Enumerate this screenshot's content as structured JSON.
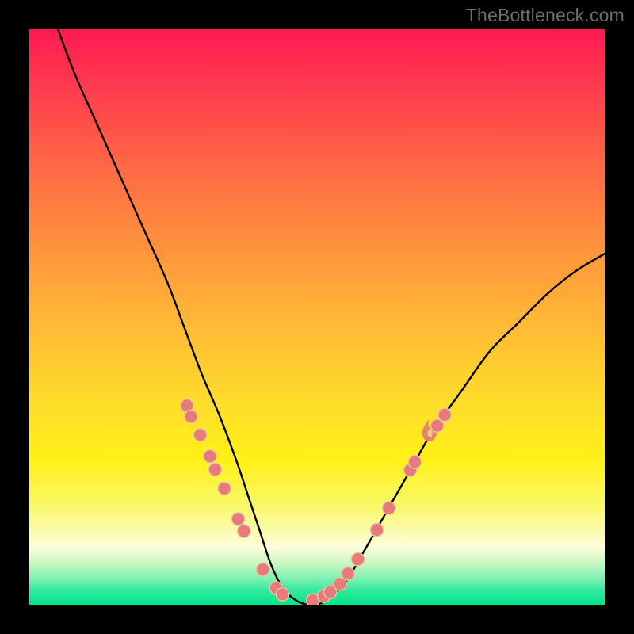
{
  "watermark": "TheBottleneck.com",
  "colors": {
    "frame": "#000000",
    "curve": "#000000",
    "dot_fill": "#e97a7a",
    "dot_stroke": "#e4c8a1",
    "gradient_top": "#ff1a52",
    "gradient_bottom": "#00e588"
  },
  "chart_data": {
    "type": "line",
    "title": "",
    "xlabel": "",
    "ylabel": "",
    "xlim": [
      0,
      100
    ],
    "ylim": [
      0,
      100
    ],
    "notes": "Bottleneck curve. No axis ticks or numeric labels are shown; x and y are normalized 0–100 within the plot area. y=0 is the bottom (green) edge, y=100 is the top (red) edge. Minimum (y≈0) is a flat region roughly x∈[42,52].",
    "series": [
      {
        "name": "bottleneck-curve",
        "x": [
          5,
          8,
          12,
          16,
          20,
          24,
          27,
          30,
          33,
          36,
          38,
          40,
          42,
          44,
          46,
          48,
          50,
          52,
          55,
          58,
          62,
          66,
          70,
          75,
          80,
          85,
          90,
          95,
          100
        ],
        "y": [
          100,
          92,
          83,
          74,
          65,
          56,
          48,
          40,
          33,
          25,
          19,
          13,
          7,
          3,
          1,
          0,
          0,
          1,
          4,
          9,
          16,
          23,
          30,
          37,
          44,
          49,
          54,
          58,
          61
        ]
      }
    ],
    "dots_left": [
      {
        "x": 27.4,
        "y": 34.6
      },
      {
        "x": 28.1,
        "y": 32.7
      },
      {
        "x": 29.7,
        "y": 29.5
      },
      {
        "x": 31.4,
        "y": 25.8
      },
      {
        "x": 32.3,
        "y": 23.5
      },
      {
        "x": 33.9,
        "y": 20.2
      },
      {
        "x": 36.3,
        "y": 14.9
      },
      {
        "x": 37.3,
        "y": 12.8
      },
      {
        "x": 40.6,
        "y": 6.1
      },
      {
        "x": 42.9,
        "y": 2.9
      },
      {
        "x": 44.0,
        "y": 1.8
      }
    ],
    "dots_right": [
      {
        "x": 49.3,
        "y": 0.8
      },
      {
        "x": 51.2,
        "y": 1.5
      },
      {
        "x": 52.3,
        "y": 2.2
      },
      {
        "x": 54.0,
        "y": 3.6
      },
      {
        "x": 55.4,
        "y": 5.4
      },
      {
        "x": 57.1,
        "y": 7.9
      },
      {
        "x": 60.4,
        "y": 13.0
      },
      {
        "x": 62.5,
        "y": 16.8
      },
      {
        "x": 66.2,
        "y": 23.4
      },
      {
        "x": 67.0,
        "y": 24.8
      },
      {
        "x": 70.9,
        "y": 31.1
      },
      {
        "x": 72.2,
        "y": 33.0
      }
    ],
    "flame_marker": {
      "x": 69.5,
      "y": 30.0
    }
  }
}
